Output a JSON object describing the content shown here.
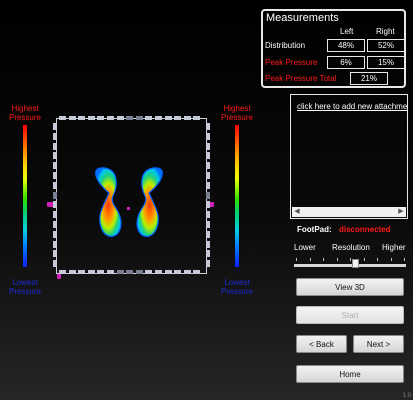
{
  "measurements": {
    "title": "Measurements",
    "col_left": "Left",
    "col_right": "Right",
    "rows": [
      {
        "label": "Distribution",
        "left": "48%",
        "right": "52%"
      },
      {
        "label": "Peak Pressure",
        "left": "6%",
        "right": "15%"
      }
    ],
    "total_label": "Peak Pressure Total",
    "total_value": "21%",
    "accent_red": "#ff1a1a"
  },
  "scale": {
    "top_label_line1": "Highest",
    "top_label_line2": "Pressure",
    "bottom_label_line1": "Lowest",
    "bottom_label_line2": "Pressure"
  },
  "attachment": {
    "link_text": "click here to add new attachment"
  },
  "footpad": {
    "label": "FootPad:",
    "status": "disconnected"
  },
  "resolution": {
    "lower": "Lower",
    "label": "Resolution",
    "higher": "Higher",
    "level": 0.55
  },
  "buttons": {
    "view3d": "View 3D",
    "start": "Start",
    "back": "< Back",
    "next": "Next >",
    "home": "Home"
  },
  "footer": "1.0"
}
